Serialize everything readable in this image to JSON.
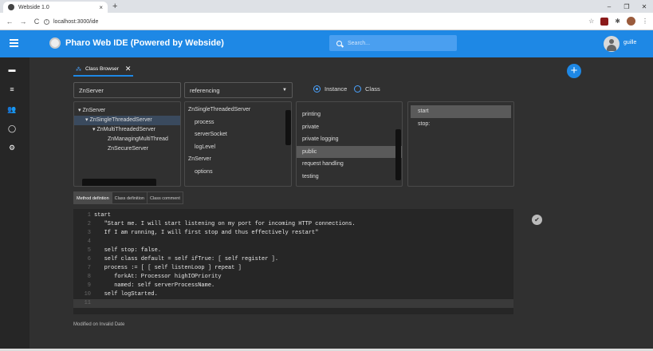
{
  "browser": {
    "tab_title": "Webside 1.0",
    "tab_close": "×",
    "new_tab": "+",
    "window_controls": [
      "–",
      "❐",
      "✕"
    ],
    "nav": [
      "←",
      "→",
      "C"
    ],
    "url": "localhost:3000/ide",
    "extensions": [
      "☆",
      "✱",
      "⋮"
    ]
  },
  "appbar": {
    "title": "Pharo Web IDE (Powered by Webside)",
    "search_placeholder": "Search...",
    "user": "guille",
    "color": "#1e88e5"
  },
  "sidebar": {
    "icons": [
      "terminal-icon",
      "list-icon",
      "people-icon",
      "github-icon",
      "settings-icon"
    ],
    "glyphs": [
      "▬",
      "≡",
      "👥",
      "◯",
      "⚙"
    ]
  },
  "class_browser": {
    "tab_label": "Class Browser",
    "tab_close": "✕",
    "add_label": "+",
    "class_input": "ZnServer",
    "mode_select": "referencing",
    "scope": {
      "instance_label": "Instance",
      "class_label": "Class",
      "selected": "Instance"
    },
    "tree": [
      {
        "label": "ZnServer",
        "toggle": "▾"
      },
      {
        "label": "ZnSingleThreadedServer",
        "toggle": "▾"
      },
      {
        "label": "ZnMultiThreadedServer",
        "toggle": "▾"
      },
      {
        "label": "ZnManagingMultiThread",
        "toggle": ""
      },
      {
        "label": "ZnSecureServer",
        "toggle": ""
      }
    ],
    "variables": [
      {
        "label": "ZnSingleThreadedServer",
        "header": true
      },
      {
        "label": "process",
        "header": false
      },
      {
        "label": "serverSocket",
        "header": false
      },
      {
        "label": "logLevel",
        "header": false
      },
      {
        "label": "ZnServer",
        "header": true
      },
      {
        "label": "options",
        "header": false
      }
    ],
    "categories": [
      "printing",
      "private",
      "private logging",
      "public",
      "request handling",
      "testing"
    ],
    "selected_category": "public",
    "methods": [
      "start",
      "stop:"
    ],
    "selected_method": "start",
    "subtabs": [
      "Method defintion",
      "Class definition",
      "Class comment"
    ],
    "code_lines": [
      "start",
      "\t\"Start me. I will start listening on my port for incoming HTTP connections.",
      "\tIf I am running, I will first stop and thus effectively restart\"",
      "",
      "\tself stop: false.",
      "\tself class default = self ifTrue: [ self register ].",
      "\tprocess := [ [ self listenLoop ] repeat ]",
      "\t\tforkAt: Processor highIOPriority",
      "\t\tnamed: self serverProcessName.",
      "\tself logStarted.",
      ""
    ],
    "accept_icon": "✔",
    "status": "Modified on Invalid Date"
  }
}
